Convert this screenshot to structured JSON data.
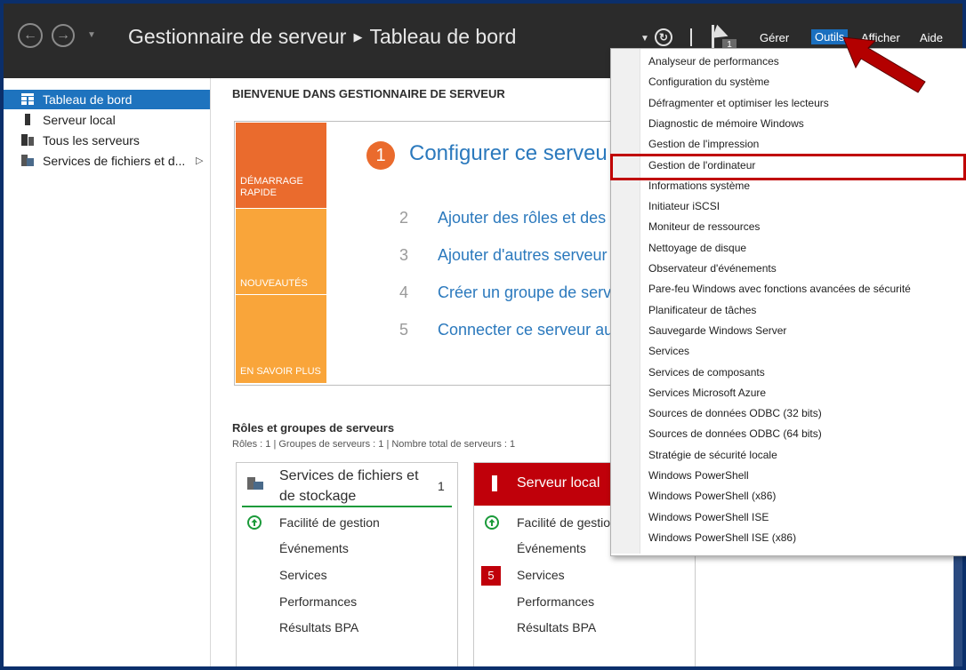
{
  "titlebar": {
    "app": "Gestionnaire de serveur",
    "page": "Tableau de bord",
    "notification_count": "1",
    "menu": [
      "Gérer",
      "Outils",
      "Afficher",
      "Aide"
    ]
  },
  "sidebar": {
    "items": [
      {
        "label": "Tableau de bord"
      },
      {
        "label": "Serveur local"
      },
      {
        "label": "Tous les serveurs"
      },
      {
        "label": "Services de fichiers et d..."
      }
    ]
  },
  "welcome": {
    "heading": "BIENVENUE DANS GESTIONNAIRE DE SERVEUR",
    "tiles": [
      "DÉMARRAGE RAPIDE",
      "NOUVEAUTÉS",
      "EN SAVOIR PLUS"
    ],
    "steps": [
      {
        "num": "1",
        "text": "Configurer ce serveu"
      },
      {
        "num": "2",
        "text": "Ajouter des rôles et des"
      },
      {
        "num": "3",
        "text": "Ajouter d'autres serveur"
      },
      {
        "num": "4",
        "text": "Créer un groupe de serv"
      },
      {
        "num": "5",
        "text": "Connecter ce serveur au"
      }
    ]
  },
  "roles": {
    "title": "Rôles et groupes de serveurs",
    "subtitle": "Rôles : 1  |  Groupes de serveurs : 1  |  Nombre total de serveurs : 1",
    "cards": [
      {
        "title_line1": "Services de fichiers et",
        "title_line2": "de stockage",
        "count": "1",
        "rows": [
          "Facilité de gestion",
          "Événements",
          "Services",
          "Performances",
          "Résultats BPA"
        ]
      },
      {
        "title": "Serveur local",
        "services_badge": "5",
        "rows": [
          "Facilité de gestio",
          "Événements",
          "Services",
          "Performances",
          "Résultats BPA"
        ]
      }
    ]
  },
  "tools_menu": {
    "items": [
      "Analyseur de performances",
      "Configuration du système",
      "Défragmenter et optimiser les lecteurs",
      "Diagnostic de mémoire Windows",
      "Gestion de l'impression",
      "Gestion de l'ordinateur",
      "Informations système",
      "Initiateur iSCSI",
      "Moniteur de ressources",
      "Nettoyage de disque",
      "Observateur d'événements",
      "Pare-feu Windows avec fonctions avancées de sécurité",
      "Planificateur de tâches",
      "Sauvegarde Windows Server",
      "Services",
      "Services de composants",
      "Services Microsoft Azure",
      "Sources de données ODBC (32 bits)",
      "Sources de données ODBC (64 bits)",
      "Stratégie de sécurité locale",
      "Windows PowerShell",
      "Windows PowerShell (x86)",
      "Windows PowerShell ISE",
      "Windows PowerShell ISE (x86)"
    ]
  },
  "colors": {
    "titlebar": "#2b2b2b",
    "accent_blue": "#1e73be",
    "quickstart_orange": "#ea6b2d",
    "tile_yellow": "#f9a53a",
    "local_server_red": "#c0000a",
    "annotation_red": "#c00000",
    "status_green": "#1b9a3a"
  }
}
